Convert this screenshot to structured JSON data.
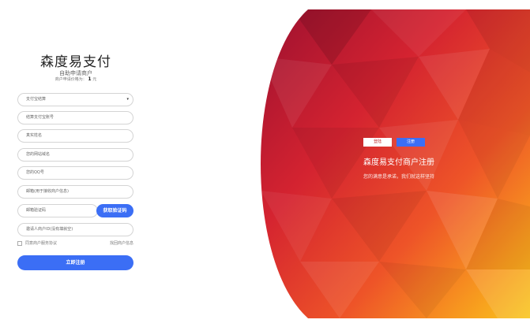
{
  "header": {
    "site_title": "森度易支付",
    "subtitle": "自助申请商户",
    "price_label": "商户申请价格为：",
    "price_value": "1",
    "price_unit": "元"
  },
  "form": {
    "settlement_select": {
      "value": "支付宝结算",
      "caret": "▾"
    },
    "alipay_account": {
      "placeholder": "结算支付宝账号"
    },
    "real_name": {
      "placeholder": "真实姓名"
    },
    "website_domain": {
      "placeholder": "您的网站域名"
    },
    "qq": {
      "placeholder": "您的QQ号"
    },
    "email": {
      "placeholder": "邮箱(用于接收商户信息)"
    },
    "email_code": {
      "placeholder": "邮箱验证码"
    },
    "get_code_label": "获取验证码",
    "invite_code": {
      "placeholder": "邀请人商户ID(没有填就空)"
    },
    "agree_label": "同意商户服务协议",
    "back_label": "找回商户信息",
    "submit_label": "立即注册"
  },
  "hero": {
    "tab_login": "登陆",
    "tab_register": "注册",
    "title": "森度易支付商户注册",
    "subtitle": "您的满意是承诺，我们就这样坚持"
  },
  "colors": {
    "accent": "#3b6ef5",
    "hero_red": "#c0172e",
    "hero_orange": "#f47a23",
    "hero_yellow": "#f8c21c"
  }
}
